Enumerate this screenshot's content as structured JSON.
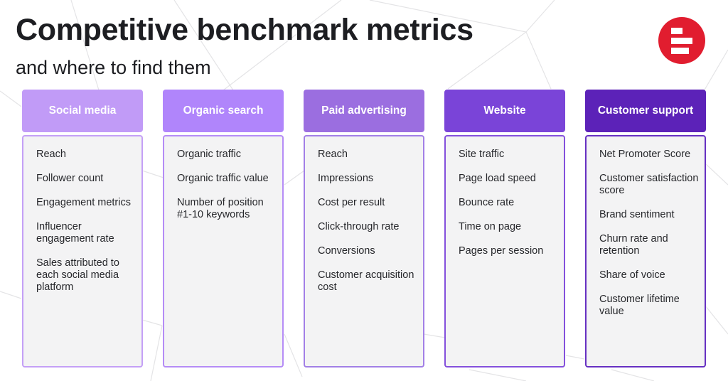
{
  "header": {
    "title": "Competitive benchmark metrics",
    "subtitle": "and where to find them"
  },
  "logo": {
    "icon": "brand-logo-icon",
    "color": "#e11d2f"
  },
  "columns": [
    {
      "label": "Social media",
      "head_color": "#c19bf7",
      "border_color": "#c4a0f6",
      "items": [
        "Reach",
        "Follower count",
        "Engagement metrics",
        "Influencer engagement rate",
        "Sales attributed to each social media platform"
      ]
    },
    {
      "label": "Organic search",
      "head_color": "#b085fb",
      "border_color": "#b58cf6",
      "items": [
        "Organic traffic",
        "Organic traffic value",
        "Number of position #1-10 keywords"
      ]
    },
    {
      "label": "Paid advertising",
      "head_color": "#9b6ee0",
      "border_color": "#a27fe6",
      "items": [
        "Reach",
        "Impressions",
        "Cost per result",
        "Click-through rate",
        "Conversions",
        "Customer acquisition cost"
      ]
    },
    {
      "label": "Website",
      "head_color": "#7a44d8",
      "border_color": "#8450dc",
      "items": [
        "Site traffic",
        "Page load speed",
        "Bounce rate",
        "Time on page",
        "Pages per session"
      ]
    },
    {
      "label": "Customer support",
      "head_color": "#5c22b8",
      "border_color": "#6630c2",
      "items": [
        "Net Promoter Score",
        "Customer satisfaction score",
        "Brand sentiment",
        "Churn rate and retention",
        "Share of voice",
        "Customer lifetime value"
      ]
    }
  ]
}
